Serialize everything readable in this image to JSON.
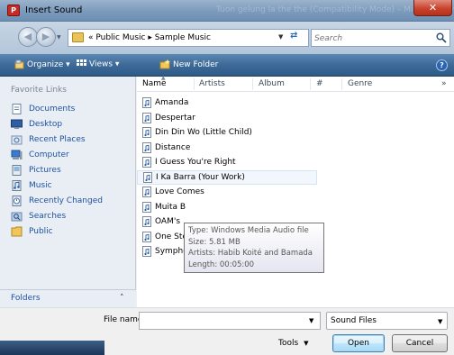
{
  "window": {
    "title": "Insert Sound",
    "title_ghost": "Tuon gelung la the the (Compatibility Mode) – Microsoft Pow...",
    "close_symbol": "✕"
  },
  "address": {
    "path": "«  Public Music  ▸  Sample Music",
    "refresh_symbol": "⇄",
    "back_symbol": "◀",
    "forward_symbol": "▶"
  },
  "search": {
    "placeholder": "Search"
  },
  "toolbar": {
    "organize": "Organize  ▾",
    "views": "Views  ▾",
    "new_folder": "New Folder",
    "help_symbol": "?"
  },
  "left_pane": {
    "heading": "Favorite Links",
    "items": [
      {
        "label": "Documents",
        "icon": "documents-icon"
      },
      {
        "label": "Desktop",
        "icon": "desktop-icon"
      },
      {
        "label": "Recent Places",
        "icon": "recent-places-icon"
      },
      {
        "label": "Computer",
        "icon": "computer-icon"
      },
      {
        "label": "Pictures",
        "icon": "pictures-icon"
      },
      {
        "label": "Music",
        "icon": "music-icon"
      },
      {
        "label": "Recently Changed",
        "icon": "recently-changed-icon"
      },
      {
        "label": "Searches",
        "icon": "searches-icon"
      },
      {
        "label": "Public",
        "icon": "public-folder-icon"
      }
    ],
    "folders_label": "Folders",
    "folders_chevron": "˄"
  },
  "columns": {
    "name": "Name",
    "artists": "Artists",
    "album": "Album",
    "number": "#",
    "genre": "Genre",
    "more": "»"
  },
  "files": [
    "Amanda",
    "Despertar",
    "Din Din Wo (Little Child)",
    "Distance",
    "I Guess You're Right",
    "I Ka Barra (Your Work)",
    "Love Comes",
    "Muita B",
    "OAM's",
    "One Ste",
    "Symphony No. 3 in E-flat major, Op. 55,..."
  ],
  "tooltip": {
    "type": "Type: Windows Media Audio file",
    "size": "Size: 5.81 MB",
    "artists": "Artists: Habib Koité and Bamada",
    "length": "Length: 00:05:00"
  },
  "bottom": {
    "file_name_label": "File name:",
    "file_name_value": "",
    "file_type": "Sound Files",
    "tools": "Tools",
    "open": "Open",
    "cancel": "Cancel"
  },
  "colors": {
    "link_blue": "#1e52a0",
    "toolbar_blue": "#3d6a98",
    "title_icon_red": "#c62a25"
  }
}
